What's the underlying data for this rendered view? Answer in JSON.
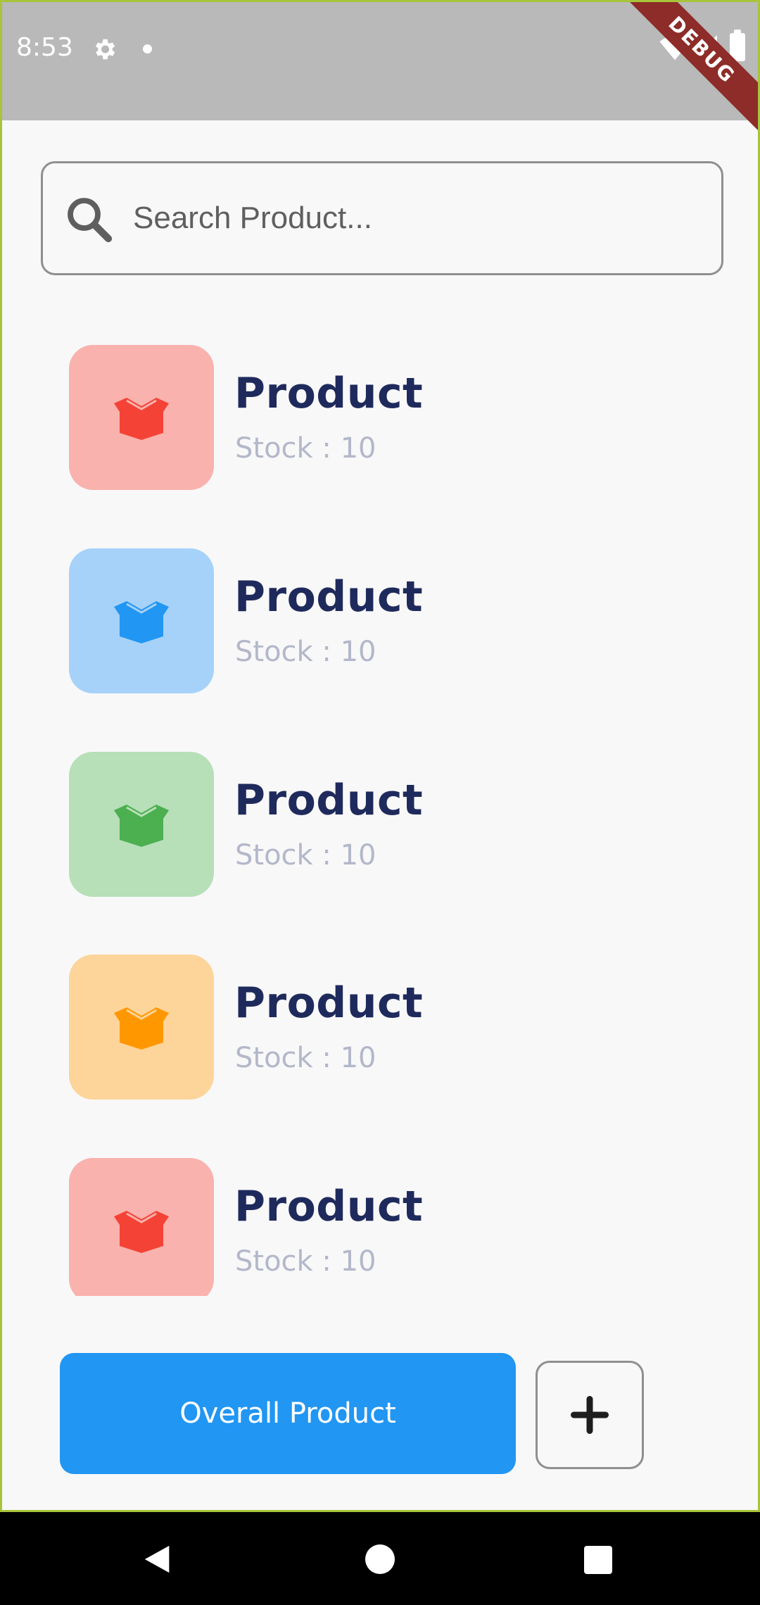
{
  "status_bar": {
    "time": "8:53",
    "icons": [
      "gear-icon",
      "notification-dot-icon",
      "wifi-icon",
      "signal-icon",
      "battery-icon"
    ],
    "debug_banner": "DEBUG"
  },
  "search": {
    "placeholder": "Search Product...",
    "value": "",
    "icon": "search-icon"
  },
  "products": [
    {
      "title": "Product",
      "stock": "Stock : 10",
      "tile_color": "#f9b2ad",
      "icon_color": "#f44336",
      "icon": "box-icon"
    },
    {
      "title": "Product",
      "stock": "Stock : 10",
      "tile_color": "#a6d2f9",
      "icon_color": "#2196f3",
      "icon": "box-icon"
    },
    {
      "title": "Product",
      "stock": "Stock : 10",
      "tile_color": "#b7dfb8",
      "icon_color": "#4caf50",
      "icon": "box-icon"
    },
    {
      "title": "Product",
      "stock": "Stock : 10",
      "tile_color": "#fdd59a",
      "icon_color": "#ff9800",
      "icon": "box-icon"
    },
    {
      "title": "Product",
      "stock": "Stock : 10",
      "tile_color": "#f9b2ad",
      "icon_color": "#f44336",
      "icon": "box-icon"
    }
  ],
  "actions": {
    "overall_label": "Overall Product",
    "add_icon": "plus-icon"
  },
  "colors": {
    "primary": "#2196f3",
    "title_text": "#1f2a5c",
    "subtitle_text": "#b3b7c9",
    "debug_ribbon": "#8d2c28"
  },
  "nav_bar": {
    "icons": [
      "back-icon",
      "home-icon",
      "recents-icon"
    ]
  }
}
